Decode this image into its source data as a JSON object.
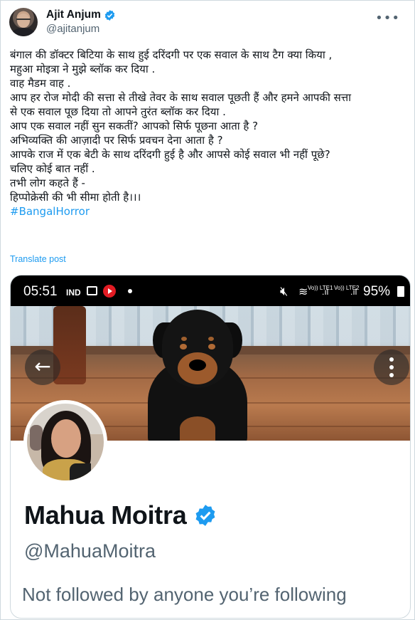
{
  "tweet": {
    "author": {
      "name": "Ajit Anjum",
      "handle": "@ajitanjum",
      "verified_color": "#1d9bf0"
    },
    "more_icon": "more-horizontal-icon",
    "lines": [
      "बंगाल की डॉक्टर बिटिया के साथ हुई दरिंदगी पर एक सवाल के साथ टैग क्या किया ,",
      "महुआ मोइत्रा ने मुझे ब्लॉक कर दिया .",
      "वाह मैडम वाह .",
      "आप हर रोज मोदी की सत्ता से तीखे तेवर के साथ सवाल पूछती हैं और हमने आपकी सत्ता",
      "से एक सवाल पूछ दिया तो आपने तुरंत ब्लॉक कर दिया .",
      "आप एक सवाल नहीं सुन सकतीं? आपको सिर्फ पूछना आता है ?",
      "अभिव्यक्ति की आज़ादी पर सिर्फ प्रवचन देना आता है ?",
      "आपके राज में एक बेटी के साथ दरिंदगी हुई है और आपसे कोई सवाल भी नहीं पूछे?",
      "चलिए कोई बात नहीं .",
      "तभी लोग कहते हैं -",
      "हिप्पोक्रेसी की भी सीमा होती है।।।"
    ],
    "hashtag": "#BangalHorror",
    "translate": "Translate post"
  },
  "screenshot": {
    "statusbar": {
      "time": "05:51",
      "carrier_icon": "IND",
      "lte1": "Vo)) LTE1",
      "lte2": "Vo)) LTE2",
      "battery": "95%"
    },
    "profile": {
      "name": "Mahua Moitra",
      "handle": "@MahuaMoitra",
      "note": "Not followed by anyone you’re following"
    }
  }
}
